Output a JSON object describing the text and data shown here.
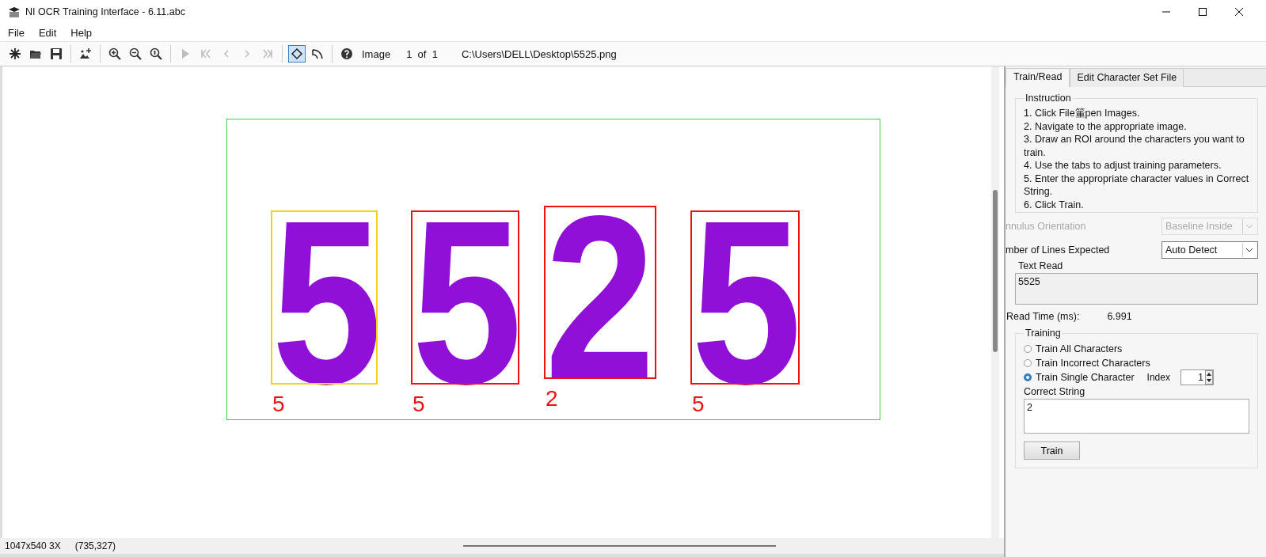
{
  "window": {
    "title": "NI OCR Training Interface - 6.11.abc"
  },
  "menu": [
    "File",
    "Edit",
    "Help"
  ],
  "toolbar": {
    "tools": [
      {
        "kind": "new",
        "disabled": false,
        "selected": false
      },
      {
        "kind": "open",
        "disabled": false,
        "selected": false
      },
      {
        "kind": "save",
        "disabled": false,
        "selected": false
      },
      {
        "kind": "sep"
      },
      {
        "kind": "add-image",
        "disabled": false,
        "selected": false
      },
      {
        "kind": "sep"
      },
      {
        "kind": "zoom-in",
        "disabled": false,
        "selected": false
      },
      {
        "kind": "zoom-out",
        "disabled": false,
        "selected": false
      },
      {
        "kind": "zoom-fit",
        "disabled": false,
        "selected": false
      },
      {
        "kind": "sep"
      },
      {
        "kind": "play",
        "disabled": true,
        "selected": false
      },
      {
        "kind": "first",
        "disabled": true,
        "selected": false
      },
      {
        "kind": "prev",
        "disabled": true,
        "selected": false
      },
      {
        "kind": "next",
        "disabled": true,
        "selected": false
      },
      {
        "kind": "last",
        "disabled": true,
        "selected": false
      },
      {
        "kind": "sep"
      },
      {
        "kind": "roi-rect",
        "disabled": false,
        "selected": true
      },
      {
        "kind": "roi-annulus",
        "disabled": false,
        "selected": false
      },
      {
        "kind": "sep"
      },
      {
        "kind": "help",
        "disabled": false,
        "selected": false
      }
    ],
    "image_label": "Image",
    "counter": "1  of  1",
    "path": "C:\\Users\\DELL\\Desktop\\5525.png"
  },
  "canvas": {
    "characters": [
      {
        "glyph": "5",
        "label": "5",
        "selected": true
      },
      {
        "glyph": "5",
        "label": "5",
        "selected": false
      },
      {
        "glyph": "2",
        "label": "2",
        "selected": false
      },
      {
        "glyph": "5",
        "label": "5",
        "selected": false
      }
    ]
  },
  "status_bar": {
    "size": "1047x540 3X",
    "position": "(735,327)"
  },
  "panel": {
    "tabs": [
      {
        "label": "Train/Read",
        "selected": true
      },
      {
        "label": "Edit Character Set File",
        "selected": false
      }
    ],
    "instruction": {
      "title": "Instruction",
      "lines": [
        "1. Click File箽pen Images.",
        "2. Navigate to the appropriate image.",
        "3. Draw an ROI around the characters you want to train.",
        "4. Use the tabs to adjust training parameters.",
        "5. Enter the appropriate character values in Correct String.",
        "6. Click Train."
      ]
    },
    "settings": [
      {
        "label": "nnulus Orientation",
        "value": "Baseline Inside",
        "disabled": true
      },
      {
        "label": "mber of Lines Expected",
        "value": "Auto Detect",
        "disabled": false
      }
    ],
    "text_read": {
      "label": "Text Read",
      "value": "5525"
    },
    "read_time": {
      "label": "Read Time (ms):",
      "value": "6.991"
    },
    "training": {
      "title": "Training",
      "options": [
        {
          "label": "Train All Characters",
          "selected": false
        },
        {
          "label": "Train Incorrect Characters",
          "selected": false
        },
        {
          "label": "Train Single Character",
          "selected": true
        }
      ],
      "index_label": "Index",
      "index_value": "1",
      "correct_label": "Correct String",
      "correct_value": "2",
      "button": "Train"
    }
  }
}
